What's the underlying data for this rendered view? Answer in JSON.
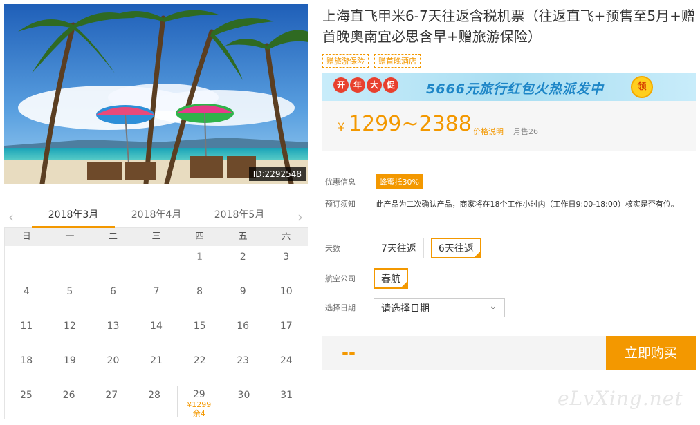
{
  "photo": {
    "id_label": "ID:2292548"
  },
  "calendar": {
    "months": [
      "2018年3月",
      "2018年4月",
      "2018年5月"
    ],
    "weekdays": [
      "日",
      "一",
      "二",
      "三",
      "四",
      "五",
      "六"
    ],
    "weeks": [
      [
        "",
        "",
        "",
        "",
        "1",
        "2",
        "3"
      ],
      [
        "4",
        "5",
        "6",
        "7",
        "8",
        "9",
        "10"
      ],
      [
        "11",
        "12",
        "13",
        "14",
        "15",
        "16",
        "17"
      ],
      [
        "18",
        "19",
        "20",
        "21",
        "22",
        "23",
        "24"
      ],
      [
        "25",
        "26",
        "27",
        "28",
        "29",
        "30",
        "31"
      ]
    ],
    "special": {
      "price": "¥1299",
      "remain": "余4"
    }
  },
  "product": {
    "title": "上海直飞甲米6-7天往返含税机票（往返直飞+预售至5月+赠首晚奥南宜必思含早+赠旅游保险）",
    "tags": [
      "赠旅游保险",
      "赠首晚酒店"
    ]
  },
  "promo": {
    "badge": [
      "开",
      "年",
      "大",
      "促"
    ],
    "text": "5666元旅行红包火热派发中",
    "coin": "领"
  },
  "price": {
    "yen": "¥",
    "range": "1299~2388",
    "explain": "价格说明",
    "sold": "月售26"
  },
  "info": {
    "discount_label": "优惠信息",
    "discount_badge": "蜂蜜抵30%",
    "notice_label": "预订须知",
    "notice_text": "此产品为二次确认产品，商家将在18个工作小时内（工作日9:00-18:00）核实是否有位。"
  },
  "options": {
    "days_label": "天数",
    "days": [
      "7天往返",
      "6天往返"
    ],
    "airline_label": "航空公司",
    "airline": "春航",
    "date_label": "选择日期",
    "date_value": "请选择日期"
  },
  "buy": {
    "dash": "--",
    "button": "立即购买"
  },
  "watermark": "eLvXing.net"
}
